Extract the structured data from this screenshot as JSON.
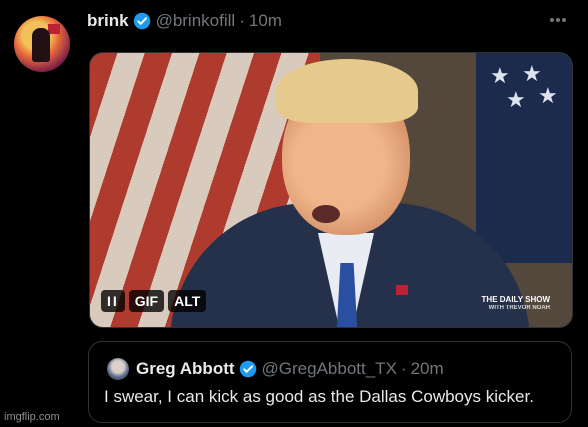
{
  "tweet": {
    "name": "brink",
    "handle": "@brinkofill",
    "separator": "·",
    "time": "10m",
    "more_icon": "more-icon",
    "media": {
      "badges": [
        "II",
        "GIF",
        "ALT"
      ],
      "watermark": "THE DAILY SHOW",
      "watermark_sub": "WITH TREVOR NOAH"
    }
  },
  "quoted": {
    "name": "Greg Abbott",
    "handle": "@GregAbbott_TX",
    "separator": "·",
    "time": "20m",
    "text": "I swear, I can kick as good as the Dallas Cowboys kicker."
  },
  "watermark": "imgflip.com",
  "colors": {
    "verified": "#1d9bf0",
    "background": "#000000",
    "muted": "#71767b"
  }
}
